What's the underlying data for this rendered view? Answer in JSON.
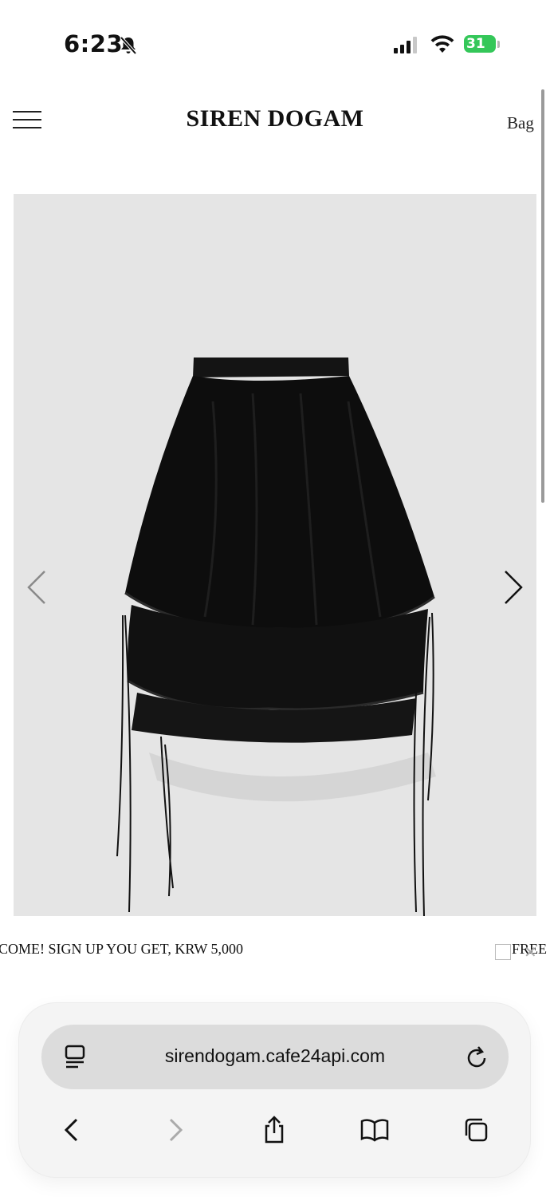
{
  "status_bar": {
    "time": "6:23",
    "battery_level": "31",
    "icons": [
      "bell-slash-icon",
      "cellular-signal-icon",
      "wifi-icon",
      "battery-charging-icon"
    ]
  },
  "header": {
    "brand": "SIREN DOGAM",
    "bag_label": "Bag",
    "menu_icon": "hamburger-icon"
  },
  "product": {
    "image_description_icon": "product-photo-black-tiered-skirt",
    "prev_icon": "chevron-left-icon",
    "next_icon": "chevron-right-icon"
  },
  "marquee": {
    "text": "COME! SIGN UP YOU GET, KRW 5,000",
    "trailing_text": "FREE"
  },
  "browser": {
    "url": "sirendogam.cafe24api.com",
    "icons": [
      "reader-icon",
      "reload-icon",
      "back-icon",
      "forward-icon",
      "share-icon",
      "bookmarks-icon",
      "tabs-icon"
    ]
  },
  "colors": {
    "battery": "#34c759",
    "image_background": "#e5e5e5",
    "url_pill": "#dcdcdc"
  }
}
